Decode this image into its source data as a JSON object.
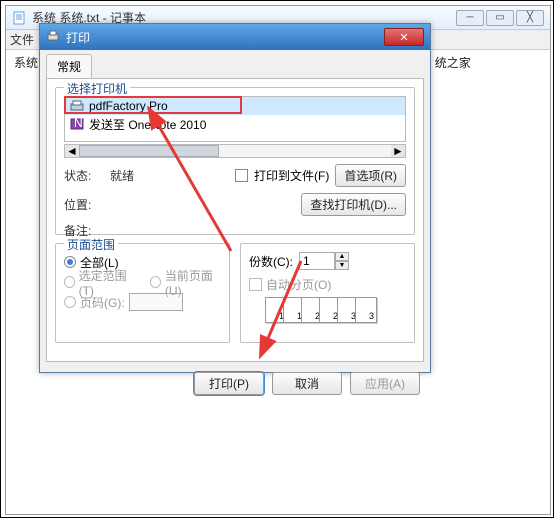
{
  "notepad": {
    "title": "系统 系统.txt - 记事本",
    "menu_file": "文件",
    "body_line": "系统",
    "body_suffix": "统之家",
    "win_min": "─",
    "win_max": "▭",
    "win_close": "╳"
  },
  "dialog": {
    "title": "打印",
    "tab_general": "常规",
    "close_glyph": "✕",
    "group_printer": "选择打印机",
    "printers": [
      {
        "name": "pdfFactory Pro",
        "selected": true
      },
      {
        "name": "发送至 OneNote 2010",
        "selected": false
      }
    ],
    "scroll_left": "◄",
    "scroll_right": "►",
    "status_label": "状态:",
    "status_value": "就绪",
    "location_label": "位置:",
    "comment_label": "备注:",
    "print_to_file": "打印到文件(F)",
    "preferences_btn": "首选项(R)",
    "find_printer_btn": "查找打印机(D)...",
    "group_range": "页面范围",
    "range_all": "全部(L)",
    "range_selection": "选定范围(T)",
    "range_current": "当前页面(U)",
    "range_pages": "页码(G):",
    "copies_label": "份数(C):",
    "copies_value": "1",
    "spin_up": "▲",
    "spin_down": "▼",
    "collate_label": "自动分页(O)",
    "pg1": "1",
    "pg2": "2",
    "pg3": "3",
    "btn_print": "打印(P)",
    "btn_cancel": "取消",
    "btn_apply": "应用(A)"
  }
}
